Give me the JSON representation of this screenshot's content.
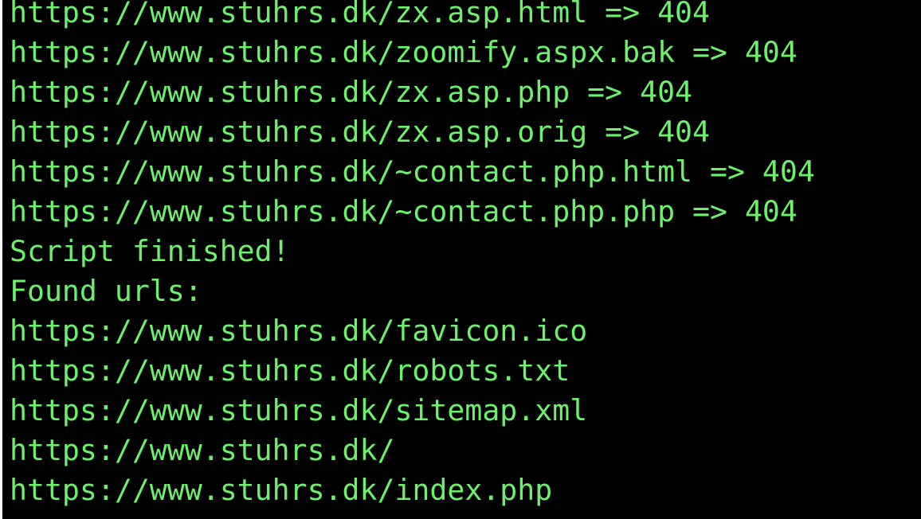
{
  "terminal": {
    "text_color": "#6BF26A",
    "background_color": "#000000",
    "lines": [
      "https://www.stuhrs.dk/zx.asp.html => 404",
      "https://www.stuhrs.dk/zoomify.aspx.bak => 404",
      "https://www.stuhrs.dk/zx.asp.php => 404",
      "https://www.stuhrs.dk/zx.asp.orig => 404",
      "https://www.stuhrs.dk/~contact.php.html => 404",
      "https://www.stuhrs.dk/~contact.php.php => 404",
      "Script finished!",
      "Found urls:",
      "https://www.stuhrs.dk/favicon.ico",
      "https://www.stuhrs.dk/robots.txt",
      "https://www.stuhrs.dk/sitemap.xml",
      "https://www.stuhrs.dk/",
      "https://www.stuhrs.dk/index.php"
    ]
  }
}
